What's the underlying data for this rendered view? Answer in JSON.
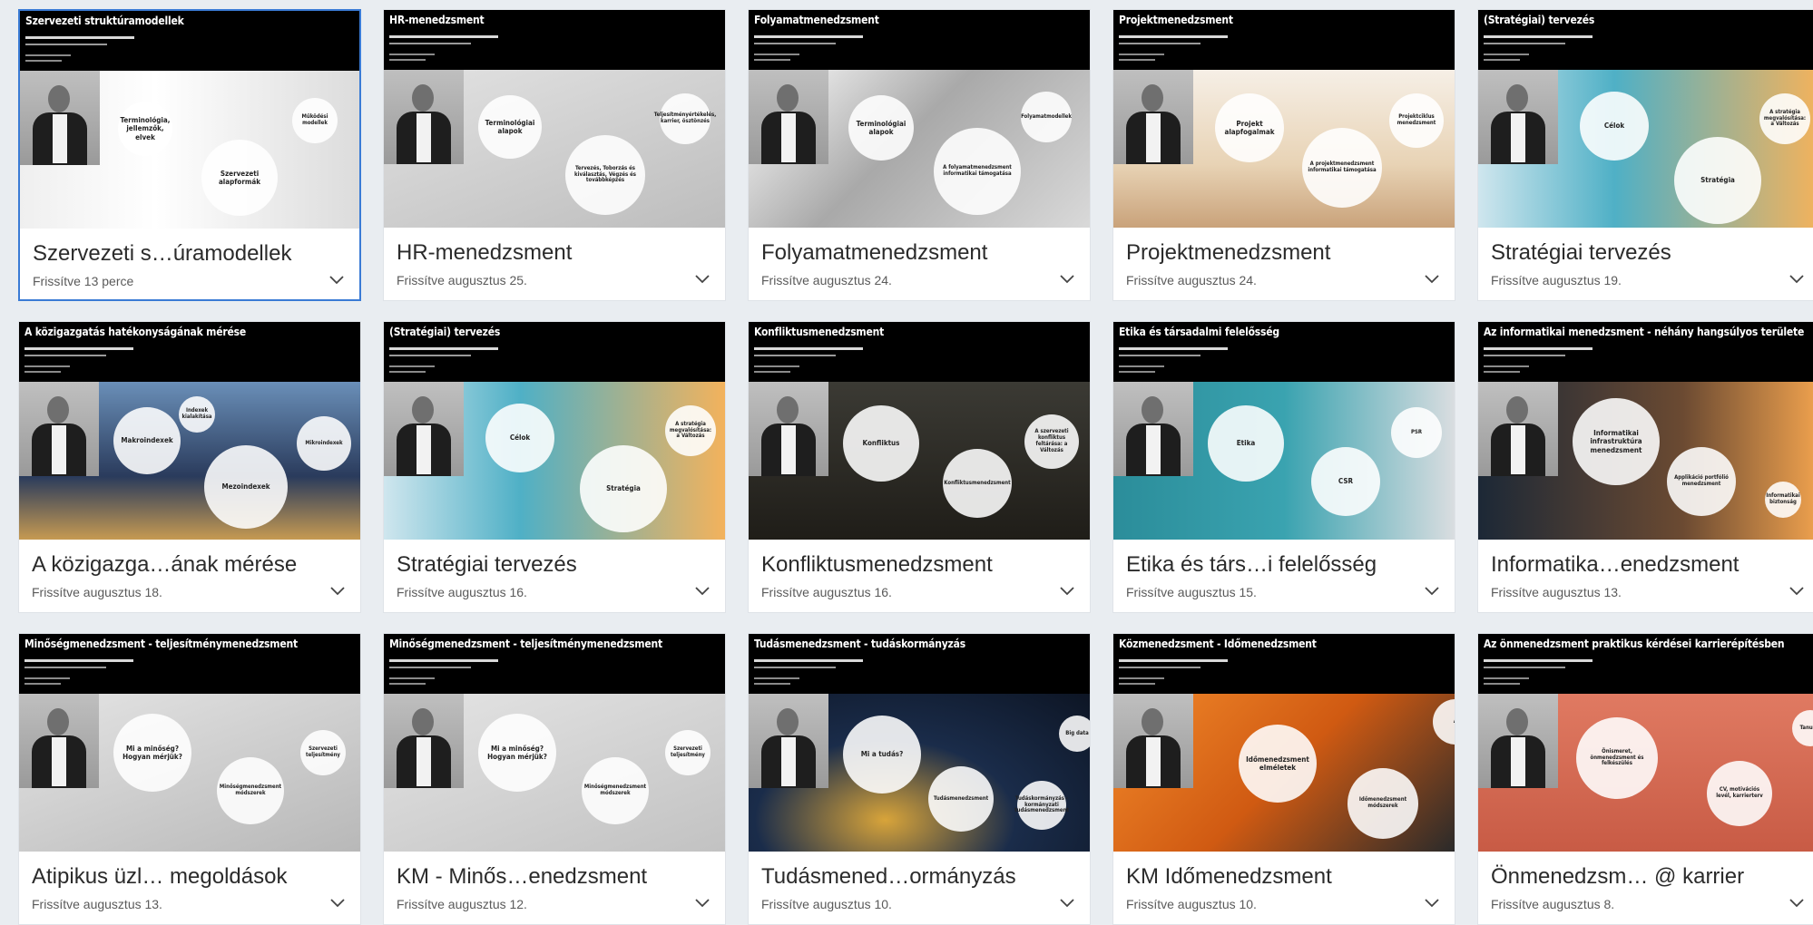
{
  "cards": [
    {
      "title": "Szervezeti s…úramodellek",
      "updated": "Frissítve 13 perce",
      "slide": "Szervezeti struktúramodellek",
      "bubbles": [
        "Terminológia, jellemzők, elvek",
        "Szervezeti alapformák",
        "Működési modellek"
      ],
      "selected": true
    },
    {
      "title": "HR-menedzsment",
      "updated": "Frissítve augusztus 25.",
      "slide": "HR-menedzsment",
      "bubbles": [
        "Terminológiai alapok",
        "Tervezés, Toborzás és kiválasztás, Végzés és továbbképzés",
        "Teljesítményértékelés, karrier, ösztönzés"
      ]
    },
    {
      "title": "Folyamatmenedzsment",
      "updated": "Frissítve augusztus 24.",
      "slide": "Folyamatmenedzsment",
      "bubbles": [
        "Terminológiai alapok",
        "A folyamatmenedzsment informatikai támogatása",
        "Folyamatmodellek"
      ]
    },
    {
      "title": "Projektmenedzsment",
      "updated": "Frissítve augusztus 24.",
      "slide": "Projektmenedzsment",
      "bubbles": [
        "Projekt alapfogalmak",
        "A projektmenedzsment informatikai támogatása",
        "Projektciklus menedzsment"
      ]
    },
    {
      "title": "Stratégiai tervezés",
      "updated": "Frissítve augusztus 19.",
      "slide": "(Stratégiai) tervezés",
      "bubbles": [
        "Célok",
        "Stratégia",
        "A stratégia megvalósítása: a Változás"
      ]
    },
    {
      "title": "A közigazga…ának mérése",
      "updated": "Frissítve augusztus 18.",
      "slide": "A közigazgatás hatékonyságának mérése",
      "bubbles": [
        "Makroindexek",
        "Mezoindexek",
        "Mikroindexek",
        "Indexek kialakítása"
      ]
    },
    {
      "title": "Stratégiai tervezés",
      "updated": "Frissítve augusztus 16.",
      "slide": "(Stratégiai) tervezés",
      "bubbles": [
        "Célok",
        "Stratégia",
        "A stratégia megvalósítása: a Változás"
      ]
    },
    {
      "title": "Konfliktusmenedzsment",
      "updated": "Frissítve augusztus 16.",
      "slide": "Konfliktusmenedzsment",
      "bubbles": [
        "Konfliktus",
        "Konfliktusmenedzsment",
        "A szervezeti konfliktus feltárása: a Változás"
      ]
    },
    {
      "title": "Etika és társ…i felelősség",
      "updated": "Frissítve augusztus 15.",
      "slide": "Etika és társadalmi felelősség",
      "bubbles": [
        "Etika",
        "CSR",
        "PSR"
      ]
    },
    {
      "title": "Informatika…enedzsment",
      "updated": "Frissítve augusztus 13.",
      "slide": "Az informatikai menedzsment - néhány hangsúlyos területe",
      "bubbles": [
        "Informatikai infrastruktúra menedzsment",
        "Applikáció portfólió menedzsment",
        "Informatikai biztonság"
      ]
    },
    {
      "title": "Atipikus üzl… megoldások",
      "updated": "Frissítve augusztus 13.",
      "slide": "Minőségmenedzsment - teljesítménymenedzsment",
      "bubbles": [
        "Mi a minőség? Hogyan mérjük?",
        "Minőségmenedzsment módszerek",
        "Szervezeti teljesítmény"
      ]
    },
    {
      "title": "KM - Minős…enedzsment",
      "updated": "Frissítve augusztus 12.",
      "slide": "Minőségmenedzsment - teljesítménymenedzsment",
      "bubbles": [
        "Mi a minőség? Hogyan mérjük?",
        "Minőségmenedzsment módszerek",
        "Szervezeti teljesítmény"
      ]
    },
    {
      "title": "Tudásmened…ormányzás",
      "updated": "Frissítve augusztus 10.",
      "slide": "Tudásmenedzsment - tudáskormányzás",
      "bubbles": [
        "Mi a tudás?",
        "Tudásmenedzsment",
        "Tudáskormányzás - kormányzati tudásmenedzsment",
        "Big data"
      ]
    },
    {
      "title": "KM Időmenedzsment",
      "updated": "Frissítve augusztus 10.",
      "slide": "Közmenedzsment - Időmenedzsment",
      "bubbles": [
        "Időmenedzsment elméletek",
        "Időmenedzsment módszerek",
        "A"
      ]
    },
    {
      "title": "Önmenedzsm… @ karrier",
      "updated": "Frissítve augusztus 8.",
      "slide": "Az önmenedzsment praktikus kérdései karrierépítésben",
      "bubbles": [
        "Önismeret, önmenedzsment és felkészülés",
        "CV, motivációs levél, karrierterv",
        "Tanulás"
      ]
    }
  ],
  "icons": {
    "chevron": "chevron-down-icon"
  },
  "colors": {
    "selected_border": "#3a7bd5",
    "card_bg": "#ffffff",
    "page_bg": "#e9edf1"
  }
}
